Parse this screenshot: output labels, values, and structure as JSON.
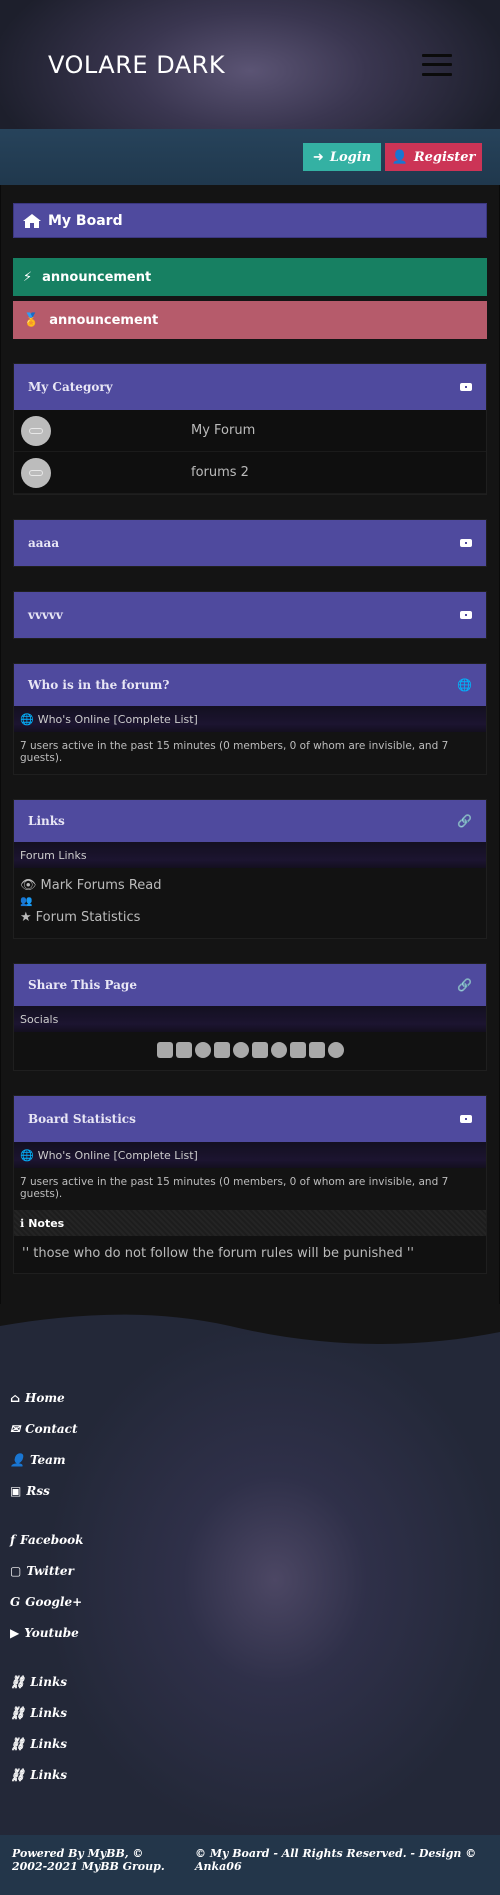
{
  "header": {
    "title": "VOLARE DARK"
  },
  "auth": {
    "login": "Login",
    "register": "Register"
  },
  "board": {
    "title": "My Board"
  },
  "announcements": [
    "announcement",
    "announcement"
  ],
  "category": {
    "title": "My Category",
    "forums": [
      "My Forum",
      "forums 2"
    ]
  },
  "collapsed_categories": [
    "aaaa",
    "vvvvv"
  ],
  "who_online": {
    "title": "Who is in the forum?",
    "sub": "Who's Online [Complete List]",
    "text": "7 users active in the past 15 minutes (0 members, 0 of whom are invisible, and 7 guests)."
  },
  "links_panel": {
    "title": "Links",
    "sub": "Forum Links",
    "items": [
      "Mark Forums Read",
      "",
      "Forum Statistics"
    ]
  },
  "share": {
    "title": "Share This Page",
    "sub": "Socials"
  },
  "stats": {
    "title": "Board Statistics",
    "sub": "Who's Online [Complete List]",
    "text": "7 users active in the past 15 minutes (0 members, 0 of whom are invisible, and 7 guests).",
    "notes_label": "Notes",
    "notes_text": "'' those who do not follow the forum rules will be punished ''"
  },
  "footer": {
    "nav": [
      "Home",
      "Contact",
      "Team",
      "Rss"
    ],
    "social": [
      "Facebook",
      "Twitter",
      "Google+",
      "Youtube"
    ],
    "links": [
      "Links",
      "Links",
      "Links",
      "Links"
    ],
    "powered": "Powered By MyBB, © 2002-2021 MyBB Group.",
    "copyright": "© My Board - All Rights Reserved. - Design © Anka06"
  },
  "colors": {
    "accent": "#4f4a9e",
    "login": "#34b1a3",
    "register": "#cc3456",
    "announce_green": "#178062",
    "announce_red": "#b65b6b"
  }
}
